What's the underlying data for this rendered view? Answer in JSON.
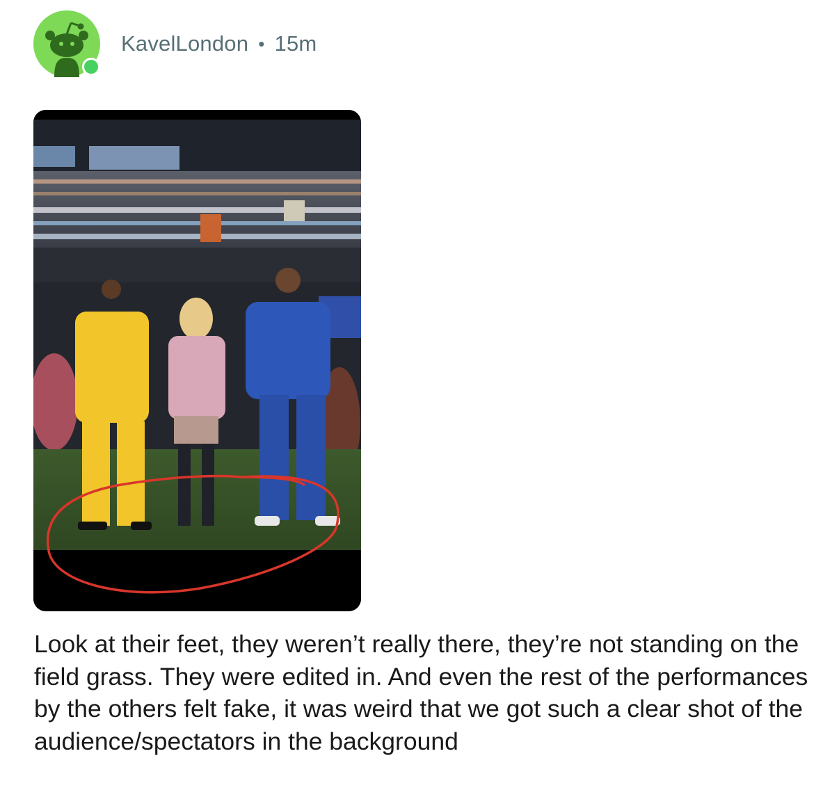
{
  "comment": {
    "author": "KavelLondon",
    "separator": "•",
    "age": "15m",
    "body": "Look at their feet, they weren’t really there, they’re not standing on the field grass. They were edited in. And even the rest of the performances by the others felt fake, it was weird that we got such a clear shot of the audience/spectators in the background"
  },
  "avatar": {
    "icon": "snoo-avatar-icon",
    "color": "#7ed957",
    "online": true,
    "online_color": "#46d160"
  },
  "media": {
    "type": "image",
    "annotation": "red-circle-around-feet"
  }
}
